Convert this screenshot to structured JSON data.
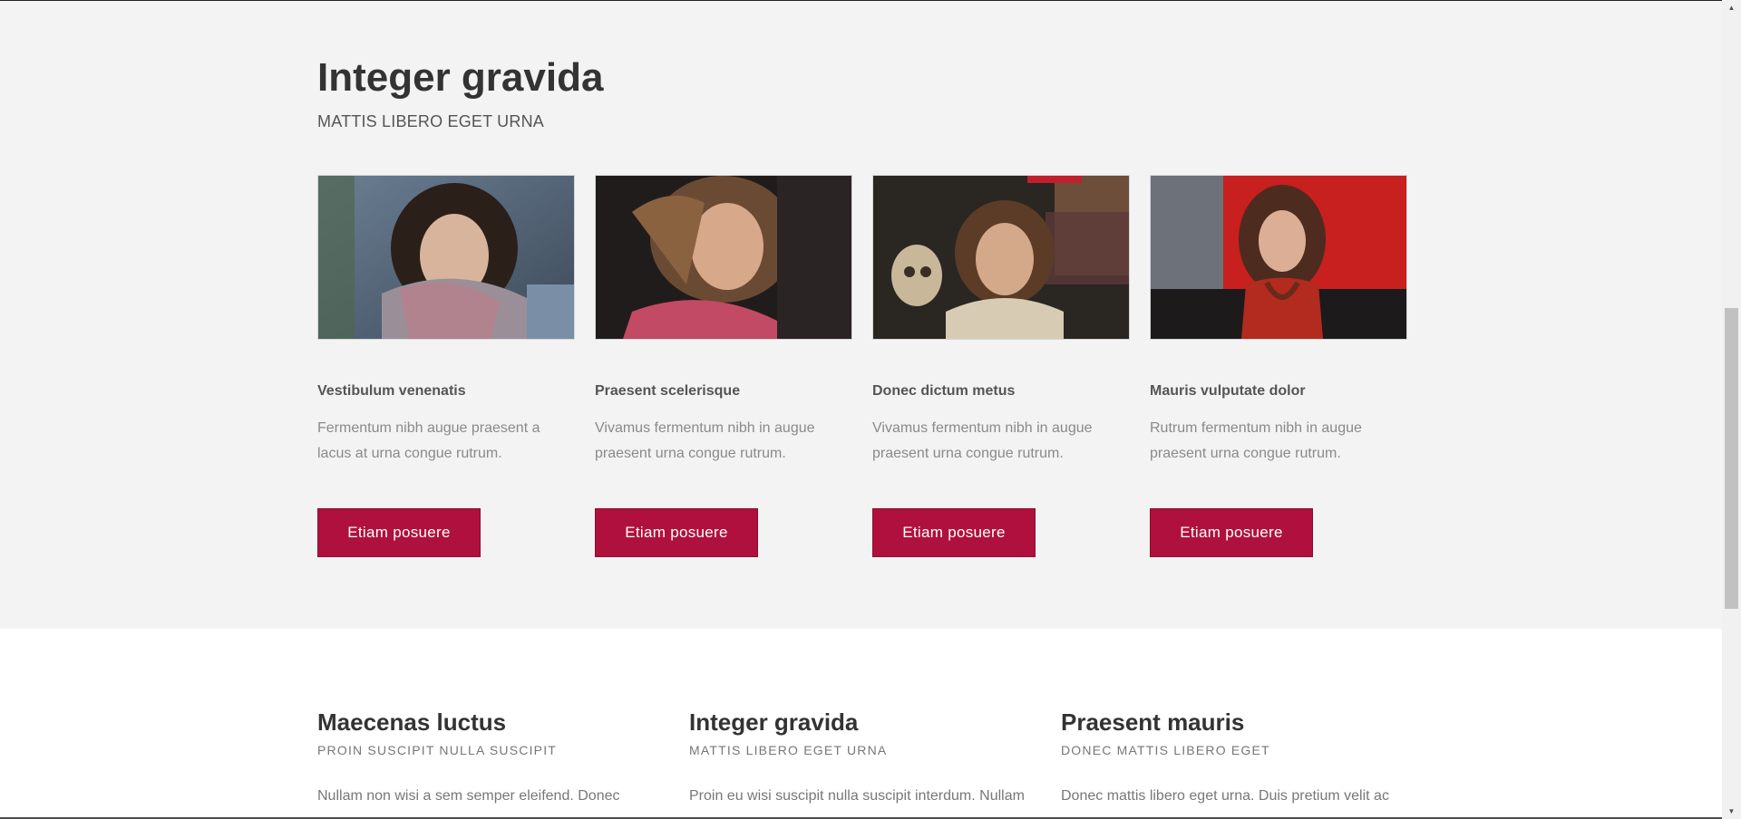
{
  "featured": {
    "title": "Integer gravida",
    "subtitle": "MATTIS LIBERO EGET URNA",
    "cards": [
      {
        "title": "Vestibulum venenatis",
        "text": "Fermentum nibh augue praesent a lacus at urna congue rutrum.",
        "button": "Etiam posuere"
      },
      {
        "title": "Praesent scelerisque",
        "text": "Vivamus fermentum nibh in augue praesent urna congue rutrum.",
        "button": "Etiam posuere"
      },
      {
        "title": "Donec dictum metus",
        "text": "Vivamus fermentum nibh in augue praesent urna congue rutrum.",
        "button": "Etiam posuere"
      },
      {
        "title": "Mauris vulputate dolor",
        "text": "Rutrum fermentum nibh in augue praesent urna congue rutrum.",
        "button": "Etiam posuere"
      }
    ]
  },
  "columns": [
    {
      "title": "Maecenas luctus",
      "subtitle": "PROIN SUSCIPIT NULLA SUSCIPIT",
      "text": "Nullam non wisi a sem semper eleifend. Donec"
    },
    {
      "title": "Integer gravida",
      "subtitle": "MATTIS LIBERO EGET URNA",
      "text": "Proin eu wisi suscipit nulla suscipit interdum. Nullam"
    },
    {
      "title": "Praesent mauris",
      "subtitle": "DONEC MATTIS LIBERO EGET",
      "text": "Donec mattis libero eget urna. Duis pretium velit ac"
    }
  ],
  "colors": {
    "featured_bg": "#f3f3f3",
    "button_bg": "#b0103d",
    "heading": "#333333",
    "body_text": "#8a8a8a"
  },
  "icons": {
    "scroll_up": "scroll-up-arrow-icon",
    "scroll_down": "scroll-down-arrow-icon"
  }
}
